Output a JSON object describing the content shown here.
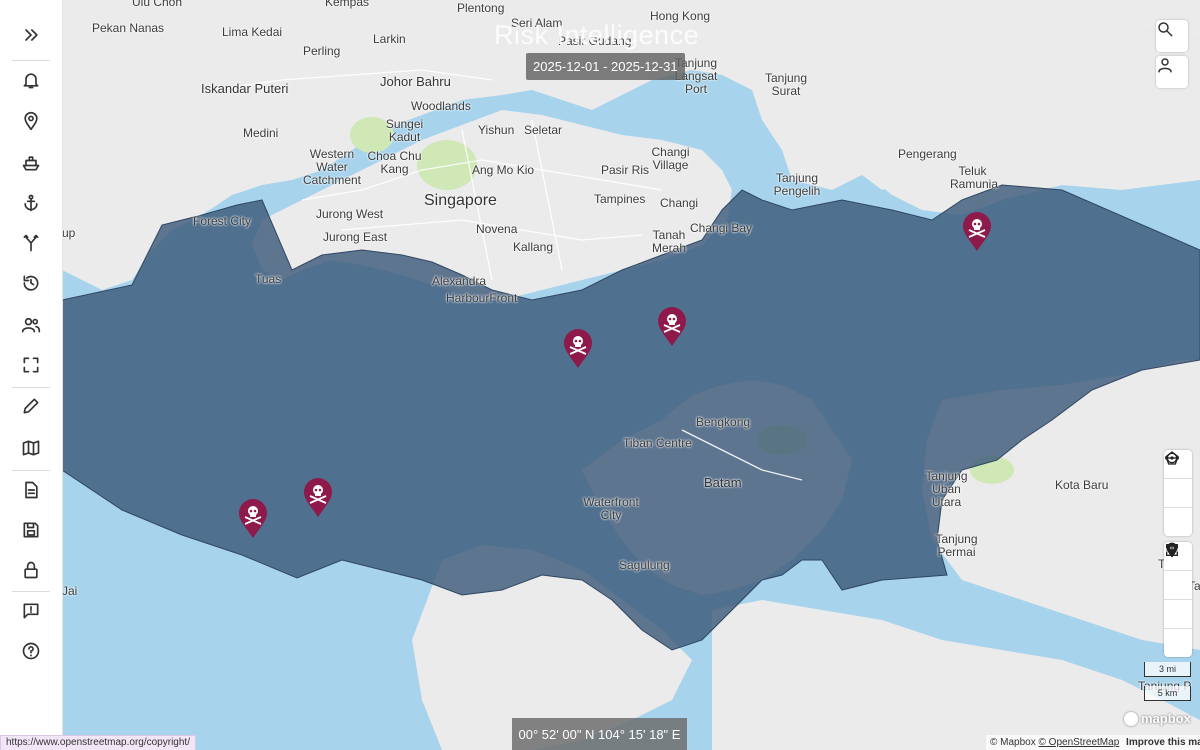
{
  "app": {
    "title_overlay": "Risk Intelligence",
    "date_range": "2025-12-01 - 2025-12-31",
    "coordinates": "00° 52' 00\" N 104° 15' 18\" E",
    "status_url": "https://www.openstreetmap.org/copyright/"
  },
  "sidebar": {
    "items": [
      {
        "name": "expand",
        "icon": "double-chevron-right-icon"
      },
      {
        "name": "alerts",
        "icon": "bell-icon"
      },
      {
        "name": "locations",
        "icon": "map-pin-icon"
      },
      {
        "name": "vessels",
        "icon": "ship-icon"
      },
      {
        "name": "ports",
        "icon": "anchor-icon"
      },
      {
        "name": "routes",
        "icon": "route-icon"
      },
      {
        "name": "history",
        "icon": "history-icon"
      },
      {
        "name": "users",
        "icon": "users-icon"
      },
      {
        "name": "fullscreen",
        "icon": "fullscreen-icon"
      },
      {
        "name": "draw",
        "icon": "pencil-icon"
      },
      {
        "name": "map",
        "icon": "map-icon"
      },
      {
        "name": "reports",
        "icon": "document-icon"
      },
      {
        "name": "save",
        "icon": "save-icon"
      },
      {
        "name": "lock",
        "icon": "lock-icon"
      },
      {
        "name": "feedback",
        "icon": "feedback-icon"
      },
      {
        "name": "help",
        "icon": "help-icon"
      }
    ]
  },
  "map": {
    "colors": {
      "water": "#a7d3ec",
      "land": "#ebebeb",
      "zone": "#5b7899",
      "pin": "#8e1a4c",
      "park": "#cfe8b5"
    },
    "labels": [
      {
        "text": "Pekan Nanas"
      },
      {
        "text": "Lima Kedai"
      },
      {
        "text": "Perling"
      },
      {
        "text": "Larkin"
      },
      {
        "text": "Plentong"
      },
      {
        "text": "Seri Alam"
      },
      {
        "text": "Pasir Gudang"
      },
      {
        "text": "Hong Kong"
      },
      {
        "text": "Tanjung Langsat Port"
      },
      {
        "text": "Tanjung Surat"
      },
      {
        "text": "Iskandar Puteri"
      },
      {
        "text": "Johor Bahru"
      },
      {
        "text": "Woodlands"
      },
      {
        "text": "Medini"
      },
      {
        "text": "Sungei Kadut"
      },
      {
        "text": "Yishun"
      },
      {
        "text": "Seletar"
      },
      {
        "text": "Western Water Catchment"
      },
      {
        "text": "Choa Chu Kang"
      },
      {
        "text": "Ang Mo Kio"
      },
      {
        "text": "Pasir Ris"
      },
      {
        "text": "Changi Village"
      },
      {
        "text": "Pengerang"
      },
      {
        "text": "Teluk Ramunia"
      },
      {
        "text": "Tanjung Pengelih"
      },
      {
        "text": "Forest City"
      },
      {
        "text": "Jurong West"
      },
      {
        "text": "Singapore"
      },
      {
        "text": "Tampines"
      },
      {
        "text": "Changi"
      },
      {
        "text": "Jurong East"
      },
      {
        "text": "Novena"
      },
      {
        "text": "Kallang"
      },
      {
        "text": "Tanah Merah"
      },
      {
        "text": "Changi Bay"
      },
      {
        "text": "Tuas"
      },
      {
        "text": "Alexandra"
      },
      {
        "text": "HarbourFront"
      },
      {
        "text": "Bengkong"
      },
      {
        "text": "Tiban Centre"
      },
      {
        "text": "Batam"
      },
      {
        "text": "Waterfront City"
      },
      {
        "text": "Sagulung"
      },
      {
        "text": "Tanjung Uban Utara"
      },
      {
        "text": "Kota Baru"
      },
      {
        "text": "Tanjung Permai"
      },
      {
        "text": "Tanjung P"
      },
      {
        "text": "Ta"
      },
      {
        "text": "Tel"
      },
      {
        "text": "Jai"
      },
      {
        "text": "up"
      },
      {
        "text": "Kempas"
      },
      {
        "text": "Ulu Choh"
      }
    ],
    "pins": [
      {
        "name": "piracy-incident-1",
        "icon": "skull-crossbones-icon",
        "lat": 1.33,
        "lon": 104.16
      },
      {
        "name": "piracy-incident-2",
        "icon": "skull-crossbones-icon",
        "lat": 1.21,
        "lon": 104.03
      },
      {
        "name": "piracy-incident-3",
        "icon": "skull-crossbones-icon",
        "lat": 1.23,
        "lon": 103.88
      },
      {
        "name": "piracy-incident-4",
        "icon": "skull-crossbones-icon",
        "lat": 1.09,
        "lon": 103.56
      },
      {
        "name": "piracy-incident-5",
        "icon": "skull-crossbones-icon",
        "lat": 1.07,
        "lon": 103.46
      }
    ],
    "scale": {
      "imperial": "3 mi",
      "metric": "5 km"
    },
    "attribution": {
      "mapbox": "© Mapbox",
      "osm": "© OpenStreetMap",
      "improve": "Improve this map"
    },
    "logo": "mapbox"
  },
  "controls": {
    "top": [
      {
        "name": "search",
        "icon": "search-icon"
      },
      {
        "name": "account",
        "icon": "user-icon"
      }
    ],
    "draw": [
      {
        "name": "measure",
        "icon": "measure-line-icon"
      },
      {
        "name": "polygon",
        "icon": "pentagon-icon"
      },
      {
        "name": "circle",
        "icon": "circle-icon"
      }
    ],
    "nav": [
      {
        "name": "locate",
        "icon": "location-pin-icon"
      },
      {
        "name": "fit",
        "icon": "fit-bounds-icon"
      },
      {
        "name": "zoom-in",
        "icon": "plus-icon"
      },
      {
        "name": "zoom-out",
        "icon": "minus-icon"
      }
    ]
  }
}
